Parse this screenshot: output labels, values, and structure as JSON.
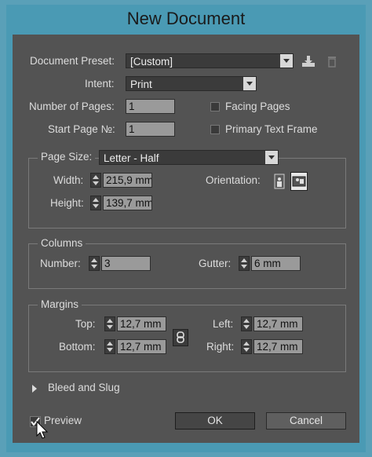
{
  "window": {
    "title": "New Document"
  },
  "preset": {
    "label": "Document Preset:",
    "value": "[Custom]"
  },
  "intent": {
    "label": "Intent:",
    "value": "Print"
  },
  "pages": {
    "label": "Number of Pages:",
    "value": "1"
  },
  "start_page": {
    "label": "Start Page №:",
    "value": "1"
  },
  "facing_pages": {
    "label": "Facing Pages",
    "checked": false
  },
  "primary_text_frame": {
    "label": "Primary Text Frame",
    "checked": false
  },
  "page_size": {
    "label": "Page Size:",
    "value": "Letter - Half",
    "width_label": "Width:",
    "width": "215,9 mm",
    "height_label": "Height:",
    "height": "139,7 mm",
    "orientation_label": "Orientation:"
  },
  "columns": {
    "title": "Columns",
    "number_label": "Number:",
    "number": "3",
    "gutter_label": "Gutter:",
    "gutter": "6 mm"
  },
  "margins": {
    "title": "Margins",
    "top_label": "Top:",
    "top": "12,7 mm",
    "bottom_label": "Bottom:",
    "bottom": "12,7 mm",
    "left_label": "Left:",
    "left": "12,7 mm",
    "right_label": "Right:",
    "right": "12,7 mm"
  },
  "bleed": {
    "label": "Bleed and Slug"
  },
  "preview": {
    "label": "Preview",
    "checked": true
  },
  "buttons": {
    "ok": "OK",
    "cancel": "Cancel"
  }
}
